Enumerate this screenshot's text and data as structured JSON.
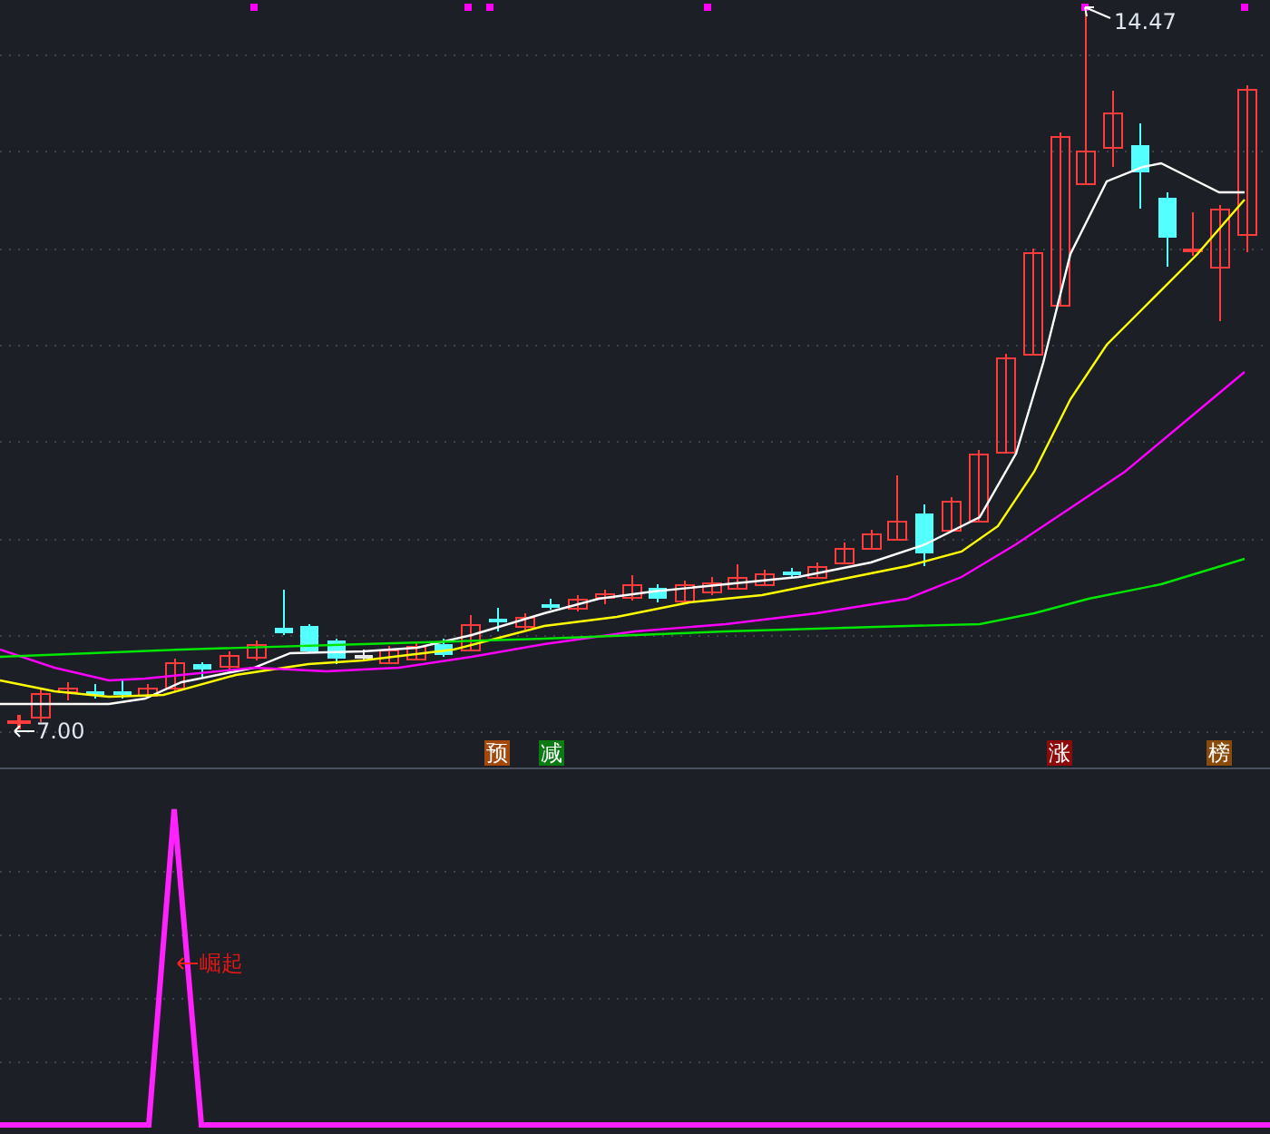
{
  "price_panel": {
    "high_label": "14.47",
    "low_label": "7.00",
    "signals": [
      {
        "text": "预",
        "color": "#a3470d"
      },
      {
        "text": "减",
        "color": "#0c7a12"
      },
      {
        "text": "涨",
        "color": "#8c0a0a"
      },
      {
        "text": "榜",
        "color": "#8a4a0a"
      }
    ]
  },
  "indicator_panel": {
    "signal_label": "崛起"
  }
}
